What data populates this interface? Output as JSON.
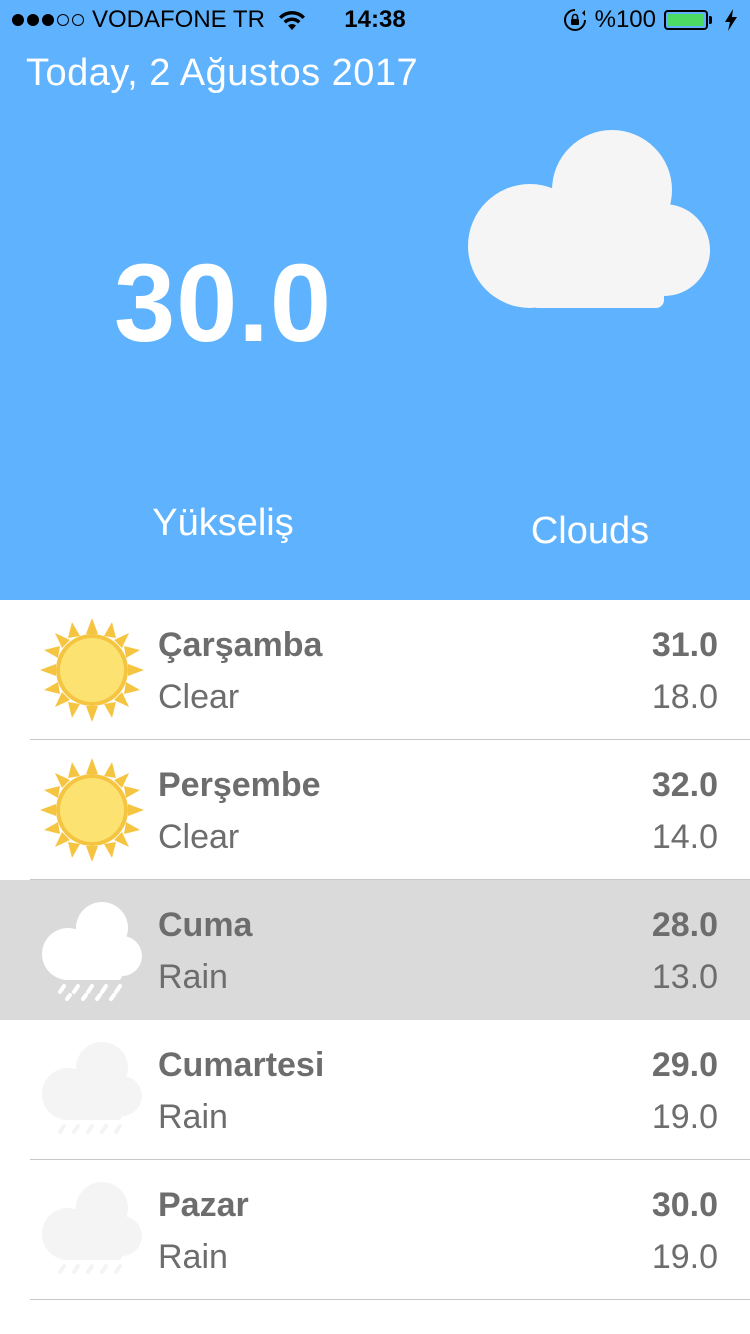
{
  "status_bar": {
    "carrier": "VODAFONE TR",
    "time": "14:38",
    "battery": "%100",
    "signal_icon": "signal-dots-icon",
    "wifi_icon": "wifi-icon",
    "rotation_lock_icon": "rotation-lock-icon",
    "battery_icon": "battery-icon",
    "charging_icon": "bolt-icon"
  },
  "header": {
    "date_title": "Today, 2 Ağustos 2017",
    "current_temp": "30.0",
    "location": "Yükseliş",
    "condition": "Clouds",
    "condition_icon": "cloud-icon",
    "background_color": "#5fb2fd"
  },
  "forecast": [
    {
      "day": "Çarşamba",
      "desc": "Clear",
      "high": "31.0",
      "low": "18.0",
      "icon": "sun-icon"
    },
    {
      "day": "Perşembe",
      "desc": "Clear",
      "high": "32.0",
      "low": "14.0",
      "icon": "sun-icon"
    },
    {
      "day": "Cuma",
      "desc": "Rain",
      "high": "28.0",
      "low": "13.0",
      "icon": "rain-cloud-icon",
      "selected": true
    },
    {
      "day": "Cumartesi",
      "desc": "Rain",
      "high": "29.0",
      "low": "19.0",
      "icon": "rain-cloud-icon"
    },
    {
      "day": "Pazar",
      "desc": "Rain",
      "high": "30.0",
      "low": "19.0",
      "icon": "rain-cloud-icon"
    }
  ]
}
